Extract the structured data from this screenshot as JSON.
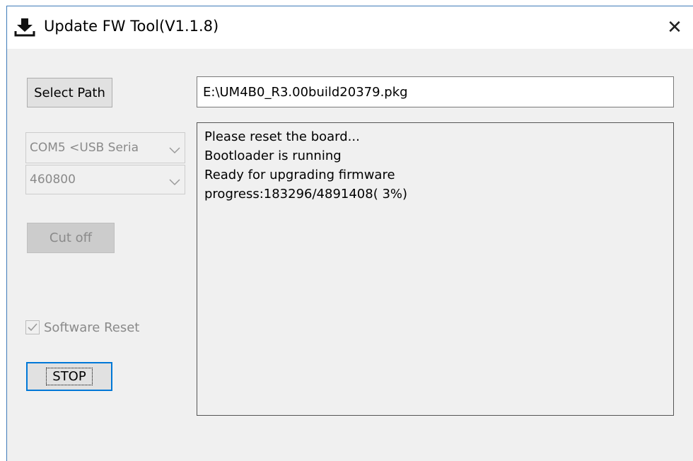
{
  "window": {
    "title": "Update FW Tool(V1.1.8)",
    "close_label": "✕"
  },
  "toolbar": {
    "select_path_label": "Select Path",
    "path_value": "E:\\UM4B0_R3.00build20379.pkg"
  },
  "serial": {
    "port_selected": "COM5 <USB Seria",
    "baud_selected": "460800",
    "cut_off_label": "Cut off"
  },
  "options": {
    "software_reset_label": "Software Reset",
    "software_reset_checked": true
  },
  "actions": {
    "stop_label": "STOP"
  },
  "log": {
    "lines": [
      "Please reset the board...",
      "Bootloader is running",
      "Ready for upgrading firmware",
      "progress:183296/4891408( 3%)"
    ]
  },
  "icons": {
    "title_icon": "download-icon",
    "close_icon": "close-icon",
    "dropdown_icon": "chevron-down-icon",
    "check_icon": "checkmark-icon"
  },
  "colors": {
    "window_bg": "#f0f0f0",
    "focus_border": "#0078d7",
    "disabled_text": "#8a8a8a"
  }
}
